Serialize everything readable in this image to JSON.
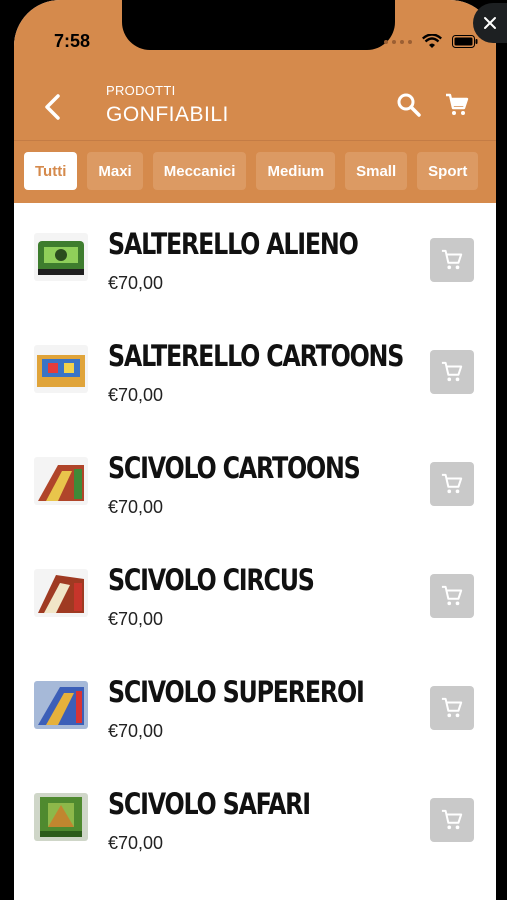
{
  "status": {
    "time": "7:58"
  },
  "header": {
    "overline": "PRODOTTI",
    "title": "GONFIABILI"
  },
  "tabs": [
    "Tutti",
    "Maxi",
    "Meccanici",
    "Medium",
    "Small",
    "Sport"
  ],
  "products": [
    {
      "name": "SALTERELLO ALIENO",
      "price": "€70,00"
    },
    {
      "name": "SALTERELLO CARTOONS",
      "price": "€70,00"
    },
    {
      "name": "SCIVOLO CARTOONS",
      "price": "€70,00"
    },
    {
      "name": "SCIVOLO CIRCUS",
      "price": "€70,00"
    },
    {
      "name": "SCIVOLO SUPEREROI",
      "price": "€70,00"
    },
    {
      "name": "SCIVOLO SAFARI",
      "price": "€70,00"
    }
  ],
  "colors": {
    "accent": "#d58a4c",
    "tab_inactive": "#dc9a63",
    "cart_button": "#c9c9c9"
  }
}
